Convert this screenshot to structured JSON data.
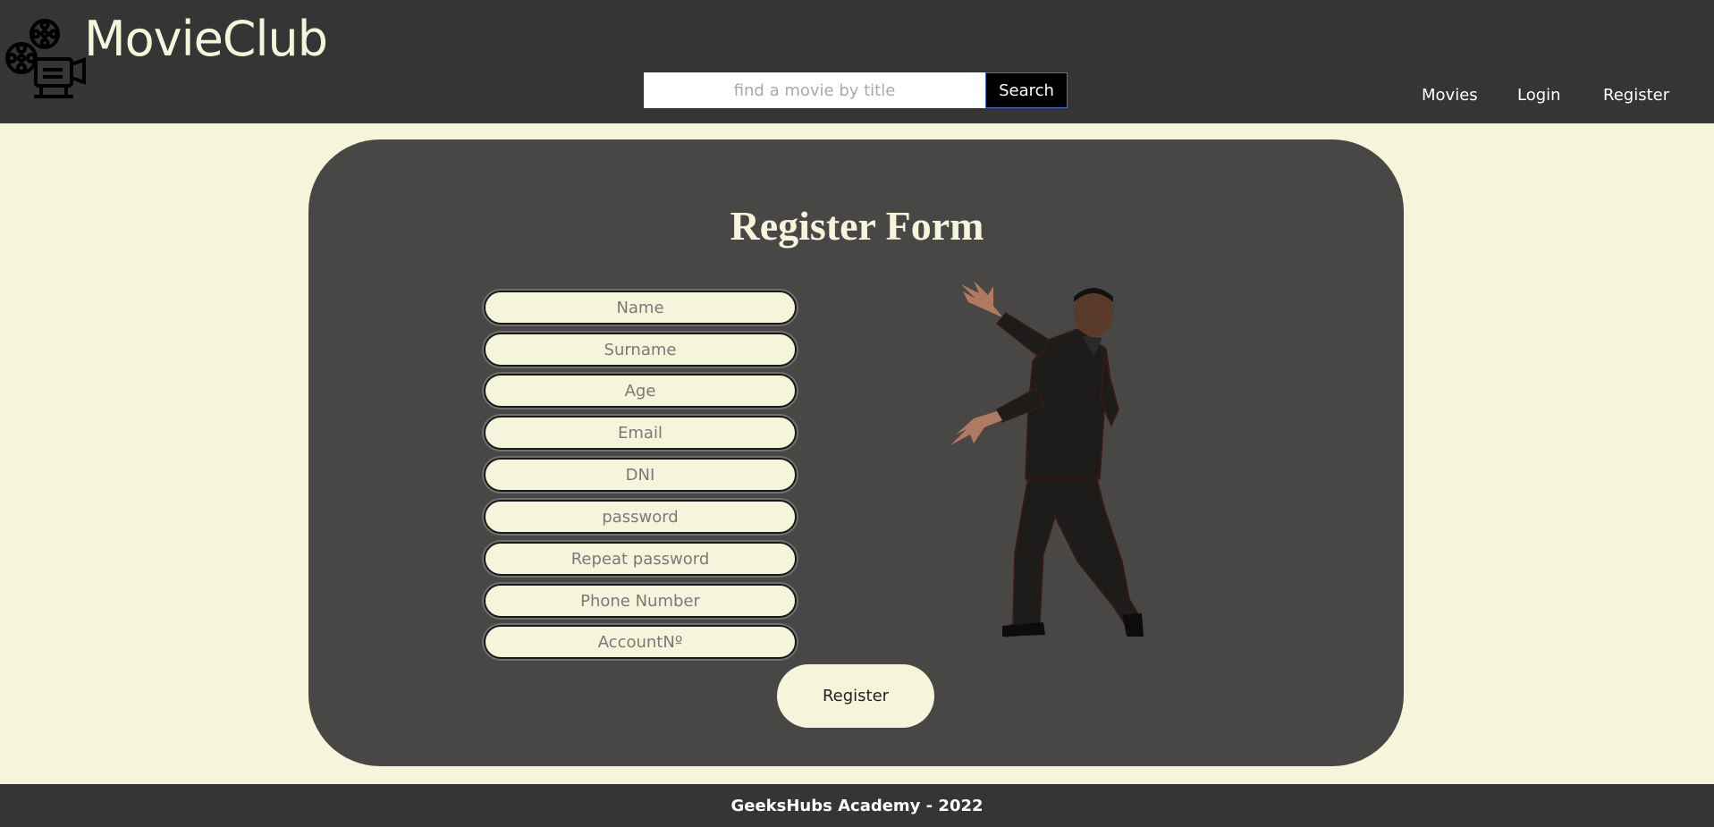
{
  "header": {
    "brand": "MovieClub",
    "search_placeholder": "find a movie by title",
    "search_value": "",
    "search_button": "Search",
    "nav": {
      "movies": "Movies",
      "login": "Login",
      "register": "Register"
    }
  },
  "form": {
    "title": "Register Form",
    "fields": {
      "name": "Name",
      "surname": "Surname",
      "age": "Age",
      "email": "Email",
      "dni": "DNI",
      "password": "password",
      "repeat_password": "Repeat password",
      "phone": "Phone Number",
      "account": "AccountNº"
    },
    "submit": "Register"
  },
  "footer": {
    "text": "GeeksHubs Academy - 2022"
  },
  "icons": {
    "logo": "film-projector-icon"
  },
  "colors": {
    "header_bg": "#353535",
    "page_bg": "#f5f5dc",
    "card_bg": "#484746",
    "accent": "#f5f5dc"
  }
}
